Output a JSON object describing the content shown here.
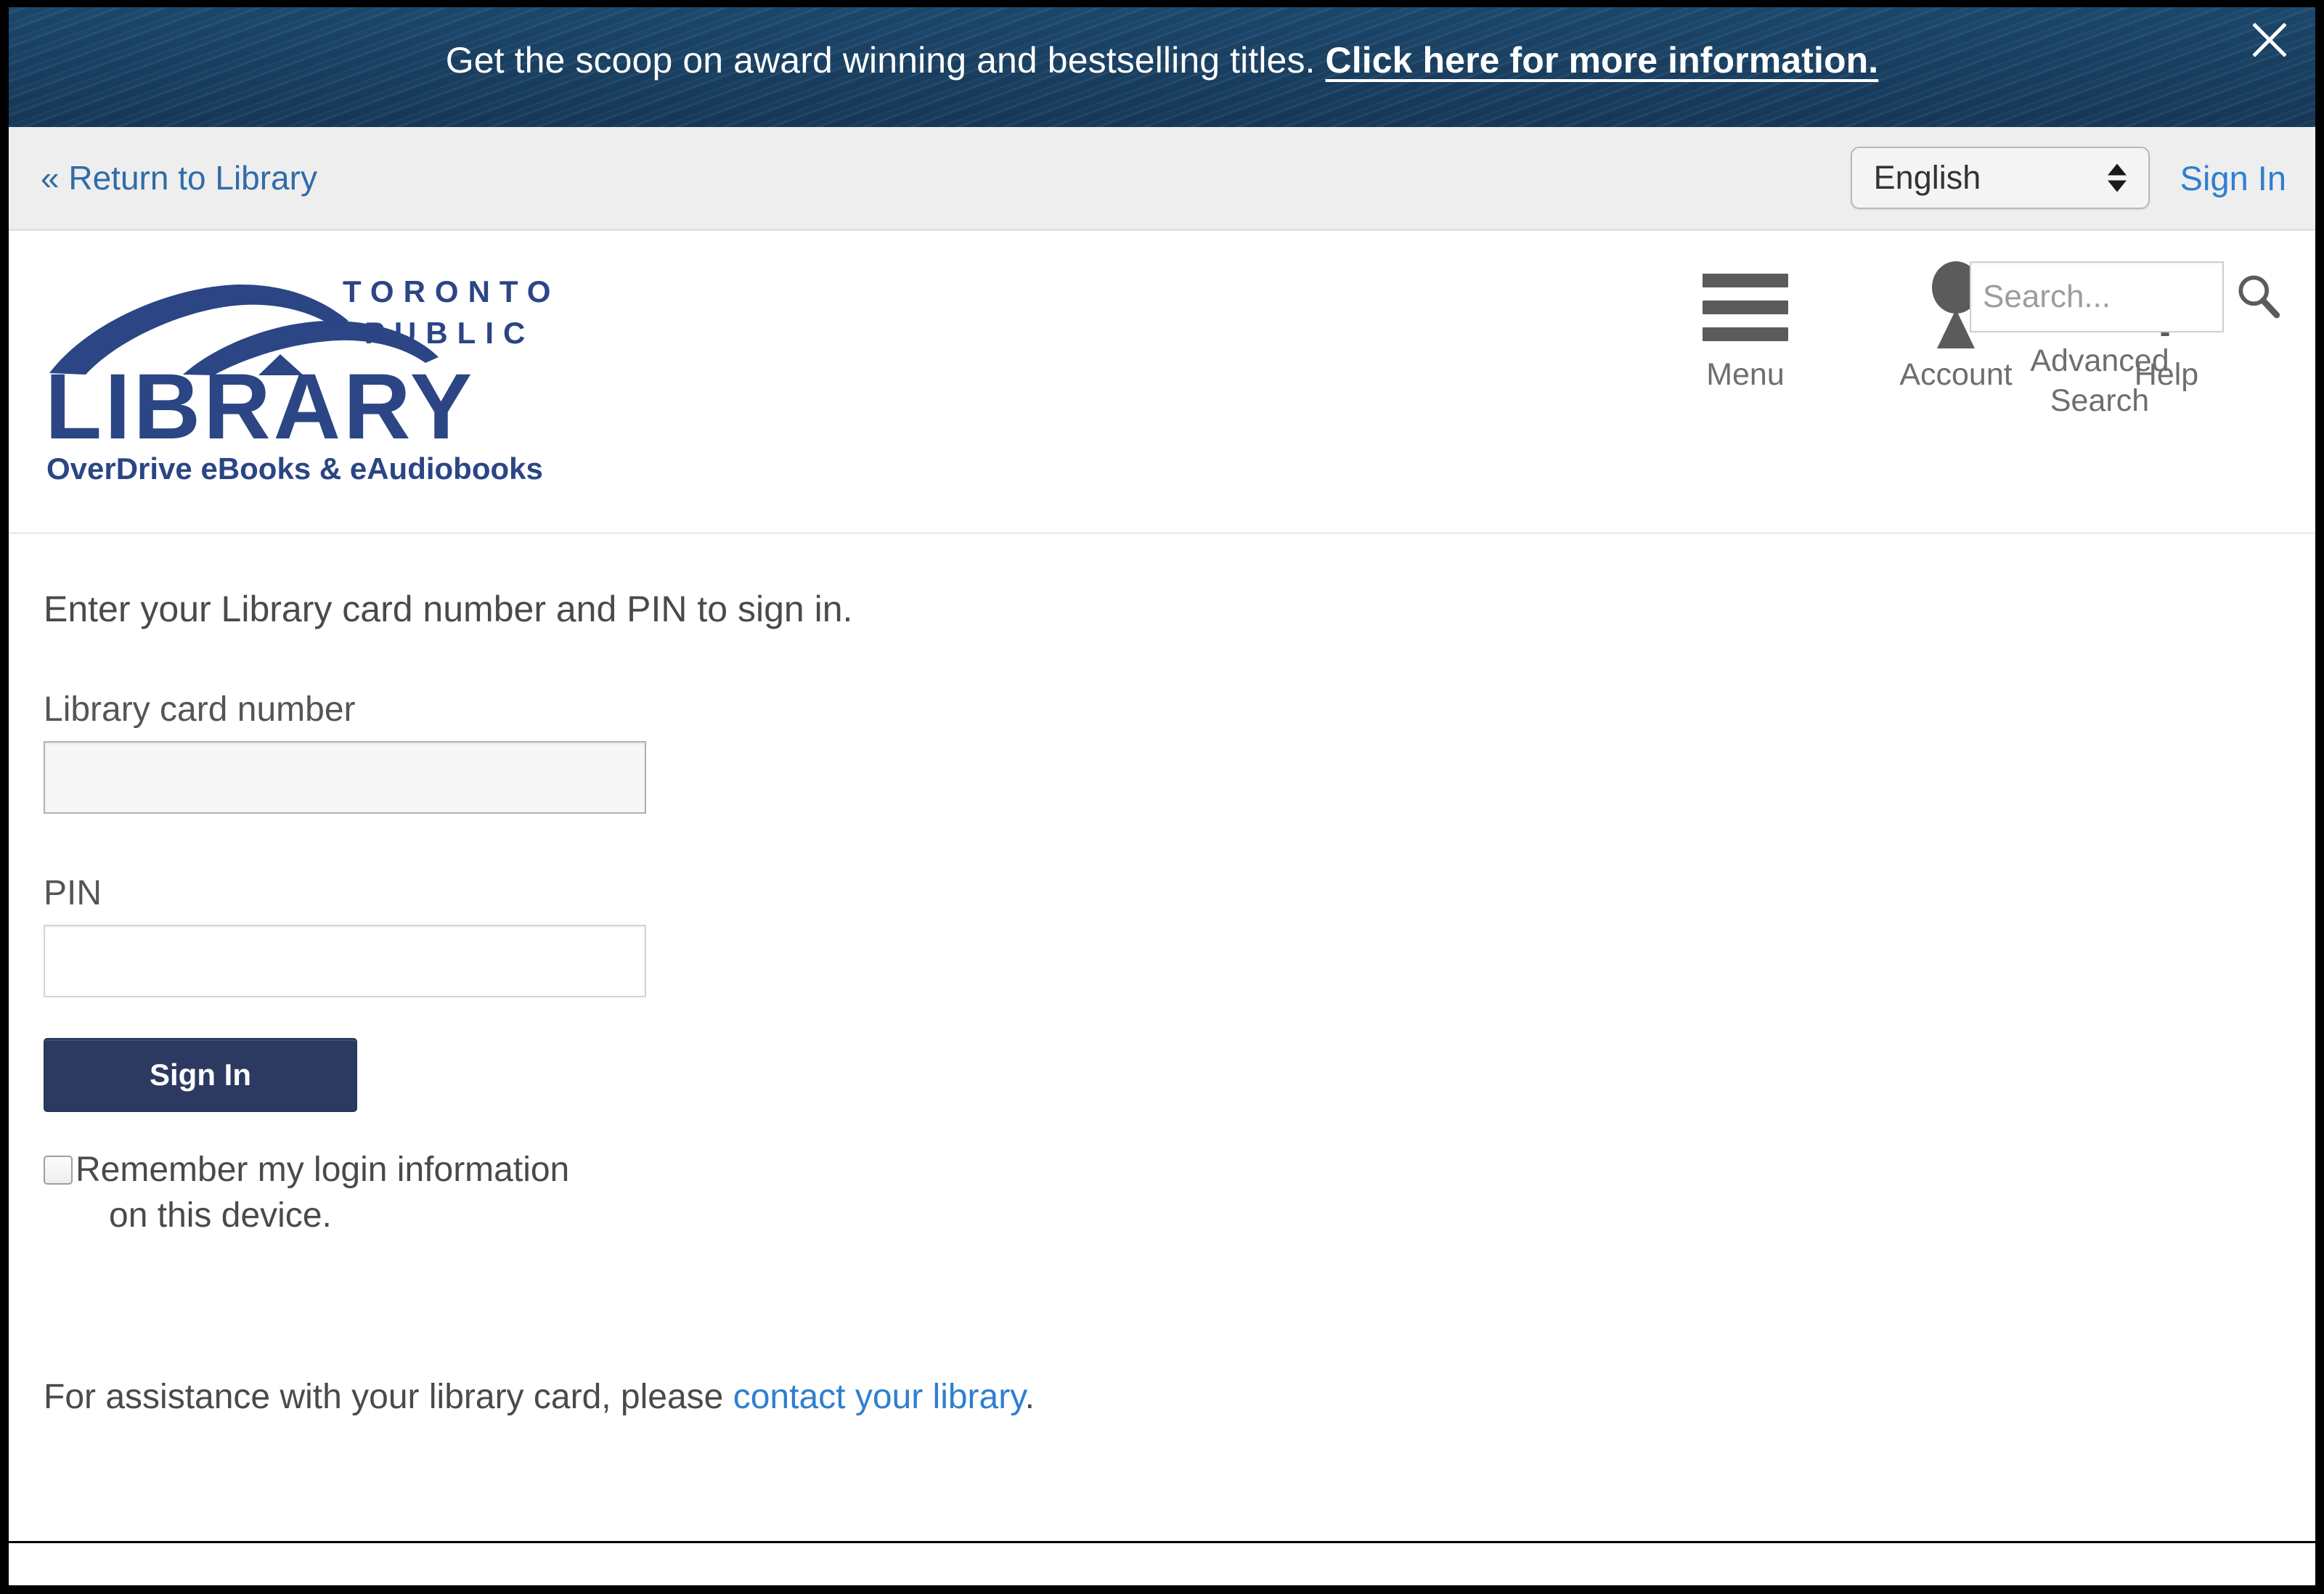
{
  "promo": {
    "message": "Get the scoop on award winning and bestselling titles. ",
    "link_label": "Click here for more information.",
    "close_icon": "close-icon",
    "bg_color": "#1b4466"
  },
  "utility_bar": {
    "return_link": "« Return to Library",
    "language": {
      "selected": "English",
      "options": [
        "English"
      ]
    },
    "sign_in_link": "Sign In",
    "link_color": "#2f7fd0"
  },
  "site_header": {
    "logo": {
      "line1": "TORONTO",
      "line2": "PUBLIC",
      "line3": "LIBRARY",
      "tagline": "OverDrive eBooks & eAudiobooks",
      "color": "#2b4585"
    },
    "nav": [
      {
        "label": "Menu",
        "icon": "hamburger-menu-icon"
      },
      {
        "label": "Account",
        "icon": "person-icon"
      },
      {
        "label": "Help",
        "icon": "question-mark-icon"
      }
    ],
    "search": {
      "placeholder": "Search...",
      "value": "",
      "icon": "magnifier-icon",
      "advanced_label_line1": "Advanced",
      "advanced_label_line2": "Search"
    }
  },
  "signin_form": {
    "intro": "Enter your Library card number and PIN to sign in.",
    "card_label": "Library card number",
    "card_value": "",
    "pin_label": "PIN",
    "pin_value": "",
    "submit_label": "Sign In",
    "submit_color": "#2c3a61",
    "remember_line1": "Remember my login information",
    "remember_line2": "on this device.",
    "remember_checked": "false"
  },
  "footer_note": {
    "prefix": "For assistance with your library card, please ",
    "link_label": "contact your library",
    "suffix": "."
  }
}
